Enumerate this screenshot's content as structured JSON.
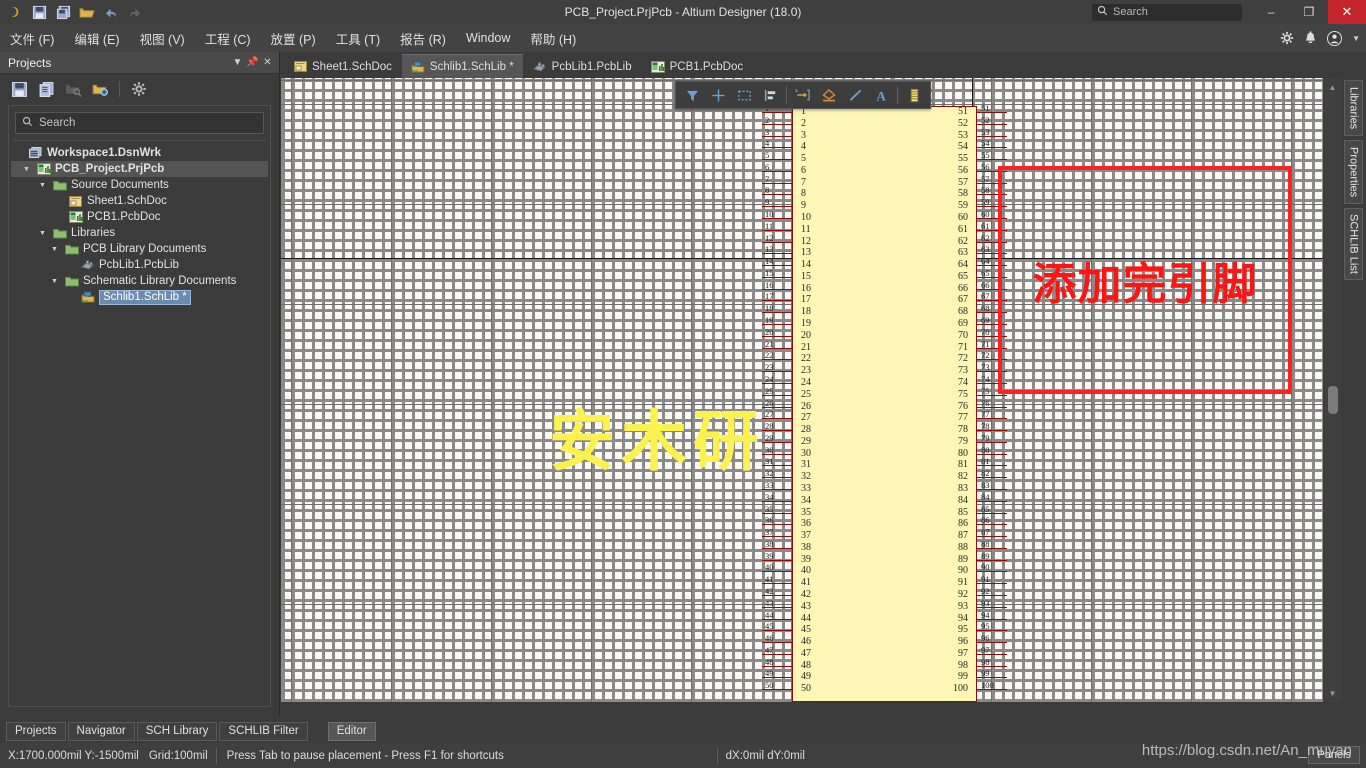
{
  "titlebar": {
    "title": "PCB_Project.PrjPcb - Altium Designer (18.0)",
    "icons": [
      "altium-logo-icon",
      "save-icon",
      "save-all-icon",
      "open-folder-icon",
      "undo-icon",
      "redo-icon"
    ],
    "search_placeholder": "Search",
    "minimize_label": "–",
    "restore_label": "❐",
    "close_label": "✕"
  },
  "menubar": {
    "items": [
      {
        "label": "文件 (F)"
      },
      {
        "label": "编辑 (E)"
      },
      {
        "label": "视图 (V)"
      },
      {
        "label": "工程 (C)"
      },
      {
        "label": "放置 (P)"
      },
      {
        "label": "工具 (T)"
      },
      {
        "label": "报告 (R)"
      },
      {
        "label": "Window"
      },
      {
        "label": "帮助 (H)"
      }
    ],
    "right_icons": [
      "gear-icon",
      "bell-icon",
      "user-icon",
      "chevron-down-icon"
    ]
  },
  "projects_panel": {
    "title": "Projects",
    "header_buttons": [
      "chevron-down-icon",
      "pin-icon",
      "close-icon"
    ],
    "toolbar_icons": [
      "save-icon",
      "documents-icon",
      "search-folder-icon",
      "folder-options-icon",
      "gear-icon"
    ],
    "search_placeholder": "Search",
    "tree": [
      {
        "label": "Workspace1.DsnWrk",
        "depth": 0,
        "icon": "workspace-icon",
        "arrow": "",
        "bold": true,
        "selected": false,
        "boxed": false
      },
      {
        "label": "PCB_Project.PrjPcb",
        "depth": 0,
        "icon": "project-icon",
        "arrow": "▼",
        "bold": true,
        "selected": true,
        "boxed": false
      },
      {
        "label": "Source Documents",
        "depth": 1,
        "icon": "folder-icon",
        "arrow": "▼",
        "bold": false,
        "selected": false,
        "boxed": false
      },
      {
        "label": "Sheet1.SchDoc",
        "depth": 2,
        "icon": "schdoc-icon",
        "arrow": "",
        "bold": false,
        "selected": false,
        "boxed": false
      },
      {
        "label": "PCB1.PcbDoc",
        "depth": 2,
        "icon": "pcbdoc-icon",
        "arrow": "",
        "bold": false,
        "selected": false,
        "boxed": false
      },
      {
        "label": "Libraries",
        "depth": 1,
        "icon": "folder-icon",
        "arrow": "▼",
        "bold": false,
        "selected": false,
        "boxed": false
      },
      {
        "label": "PCB Library Documents",
        "depth": 2,
        "icon": "folder-icon",
        "arrow": "▼",
        "bold": false,
        "selected": false,
        "boxed": false
      },
      {
        "label": "PcbLib1.PcbLib",
        "depth": 3,
        "icon": "pcblib-icon",
        "arrow": "",
        "bold": false,
        "selected": false,
        "boxed": false
      },
      {
        "label": "Schematic Library Documents",
        "depth": 2,
        "icon": "folder-icon",
        "arrow": "▼",
        "bold": false,
        "selected": false,
        "boxed": false
      },
      {
        "label": "Schlib1.SchLib *",
        "depth": 3,
        "icon": "schlib-icon",
        "arrow": "",
        "bold": false,
        "selected": false,
        "boxed": true
      }
    ]
  },
  "doctabs": [
    {
      "label": "Sheet1.SchDoc",
      "icon": "schdoc-icon",
      "active": false
    },
    {
      "label": "Schlib1.SchLib *",
      "icon": "schlib-icon",
      "active": true
    },
    {
      "label": "PcbLib1.PcbLib",
      "icon": "pcblib-icon",
      "active": false
    },
    {
      "label": "PCB1.PcbDoc",
      "icon": "pcbdoc-icon",
      "active": false
    }
  ],
  "float_toolbar": {
    "icons": [
      "filter-funnel-icon",
      "crosshair-move-icon",
      "selection-rectangle-icon",
      "align-icon",
      "place-pin-icon",
      "place-shape-icon",
      "place-line-icon",
      "place-text-icon",
      "place-component-icon"
    ]
  },
  "canvas": {
    "watermark": "安木研",
    "annotation_text": "添加完引脚",
    "annotation_color": "#ff2020",
    "component_fill": "#fdf6b5",
    "component_border": "#8a0f0f",
    "left_pins": [
      1,
      2,
      3,
      4,
      5,
      6,
      7,
      8,
      9,
      10,
      11,
      12,
      13,
      14,
      15,
      16,
      17,
      18,
      19,
      20,
      21,
      22,
      23,
      24,
      25,
      26,
      27,
      28,
      29,
      30,
      31,
      32,
      33,
      34,
      35,
      36,
      37,
      38,
      39,
      40,
      41,
      42,
      43,
      44,
      45,
      46,
      47,
      48,
      49,
      50
    ],
    "right_pins": [
      51,
      52,
      53,
      54,
      55,
      56,
      57,
      58,
      59,
      60,
      61,
      62,
      63,
      64,
      65,
      66,
      67,
      68,
      69,
      70,
      71,
      72,
      73,
      74,
      75,
      76,
      77,
      78,
      79,
      80,
      81,
      82,
      83,
      84,
      85,
      86,
      87,
      88,
      89,
      90,
      91,
      92,
      93,
      94,
      95,
      96,
      97,
      98,
      99,
      100
    ]
  },
  "right_tabs": [
    {
      "label": "Libraries"
    },
    {
      "label": "Properties"
    },
    {
      "label": "SCHLIB List"
    }
  ],
  "bottom_tabs": [
    {
      "label": "Projects",
      "active": false
    },
    {
      "label": "Navigator",
      "active": false
    },
    {
      "label": "SCH Library",
      "active": false
    },
    {
      "label": "SCHLIB Filter",
      "active": false
    },
    {
      "label": "Editor",
      "active": true
    }
  ],
  "statusbar": {
    "coordinates": "X:1700.000mil Y:-1500mil",
    "grid": "Grid:100mil",
    "hint": "Press Tab to pause placement - Press F1 for shortcuts",
    "delta": "dX:0mil dY:0mil",
    "panels_label": "Panels",
    "watermark_url": "https://blog.csdn.net/An_muyan"
  }
}
